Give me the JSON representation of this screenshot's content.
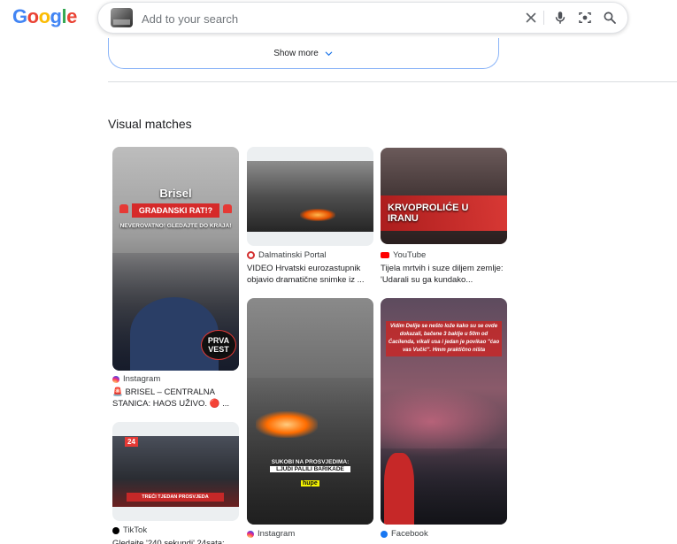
{
  "logo": {
    "letters": [
      "G",
      "o",
      "o",
      "g",
      "l",
      "e"
    ]
  },
  "search": {
    "placeholder": "Add to your search"
  },
  "show_more": {
    "label": "Show more"
  },
  "section": {
    "title": "Visual matches"
  },
  "colors": {
    "google_blue": "#4285f4",
    "google_red": "#ea4335",
    "google_yellow": "#fbbc05",
    "google_green": "#34a853",
    "border_blue": "#8ab4f8"
  },
  "results": [
    {
      "source": "Instagram",
      "source_icon": "instagram-icon",
      "title": "🚨 BRISEL – CENTRALNA STANICA: HAOS UŽIVO. 🔴 ...",
      "overlay": {
        "line1": "Brisel",
        "line2": "GRAĐANSKI RAT!?",
        "line3": "NEVEROVATNO! GLEDAJTE DO KRAJA!",
        "badge": "PRVA VEST"
      }
    },
    {
      "source": "Dalmatinski Portal",
      "source_icon": "dalmatinski-portal-icon",
      "title": "VIDEO Hrvatski eurozastupnik objavio dramatične snimke iz ..."
    },
    {
      "source": "YouTube",
      "source_icon": "youtube-icon",
      "title": "Tijela mrtvih i suze diljem zemlje: 'Udarali su ga kundako...",
      "overlay": {
        "line1": "KRVOPROLIĆE U IRANU"
      }
    },
    {
      "source": "TikTok",
      "source_icon": "tiktok-icon",
      "title": "Gledajte '240 sekundi' 24sata:",
      "overlay": {
        "badge": "24",
        "line1": "TREĆI TJEDAN PROSVJEDA"
      }
    },
    {
      "source": "Instagram",
      "source_icon": "instagram-icon",
      "title": "",
      "overlay": {
        "line1": "SUKOBI NA PROSVJEDIMA:",
        "line2": "LJUDI PALILI BARIKADE",
        "badge": "hupe"
      }
    },
    {
      "source": "Facebook",
      "source_icon": "facebook-icon",
      "title": "",
      "overlay": {
        "line1": "Vidim Delije se nešto lože kako su se ovde dokazali, bačene 3 baklje u 50m od Ćacilenda, vikali usa i jedan je povikao \"ćao vas Vučić\". Hmm praktično ništa"
      }
    }
  ]
}
